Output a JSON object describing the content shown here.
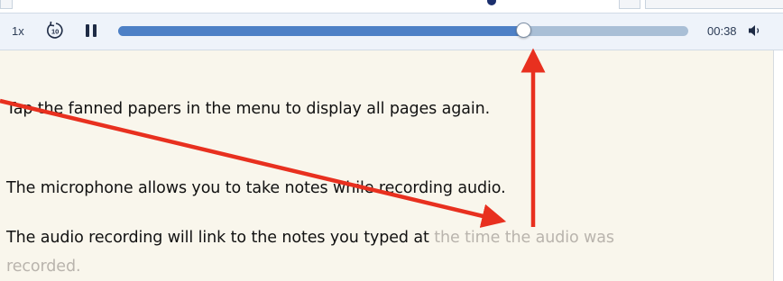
{
  "player": {
    "speed_label": "1x",
    "skip_back_seconds": "10",
    "elapsed_time": "00:38",
    "progress_fraction": 0.71
  },
  "note": {
    "line_1": "Tap the fanned papers in the menu to display all pages again.",
    "line_2": "The microphone allows you to take notes while recording audio.",
    "line_3_recorded": "The audio recording will link to the notes you typed at",
    "line_3_pending": " the time the audio was",
    "line_4_pending": "recorded."
  },
  "colors": {
    "progress_fill": "#4d80c6",
    "progress_track": "#a9bfd6",
    "annotation_arrow": "#e8301f",
    "pending_text": "#b9b4ad"
  },
  "icons": {
    "skip_back": "skip-back-10-icon",
    "pause": "pause-icon",
    "volume": "speaker-icon"
  }
}
